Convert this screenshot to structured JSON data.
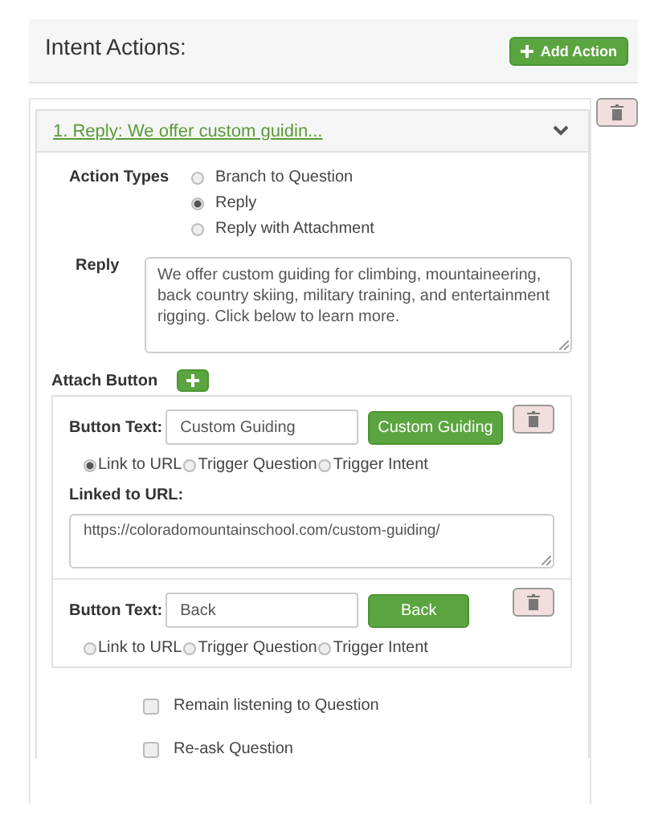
{
  "header": {
    "title": "Intent Actions:",
    "add_button": "Add Action"
  },
  "action": {
    "title": "1. Reply: We offer custom guidin...",
    "expanded": true,
    "action_types_label": "Action Types",
    "action_types": [
      {
        "label": "Branch to Question",
        "selected": false
      },
      {
        "label": "Reply",
        "selected": true
      },
      {
        "label": "Reply with Attachment",
        "selected": false
      }
    ],
    "reply_label": "Reply",
    "reply_text": "We offer custom guiding for climbing, mountaineering, back country skiing, military training, and entertainment rigging. Click below to learn more.",
    "attach_label": "Attach Button",
    "buttons": [
      {
        "label": "Button Text:",
        "value": "Custom Guiding",
        "preview": "Custom Guiding",
        "link_options": [
          {
            "label": "Link to URL",
            "selected": true
          },
          {
            "label": "Trigger Question",
            "selected": false
          },
          {
            "label": "Trigger Intent",
            "selected": false
          }
        ],
        "url_label": "Linked to URL:",
        "url": "https://coloradomountainschool.com/custom-guiding/"
      },
      {
        "label": "Button Text:",
        "value": "Back",
        "preview": "Back",
        "link_options": [
          {
            "label": "Link to URL",
            "selected": false
          },
          {
            "label": "Trigger Question",
            "selected": false
          },
          {
            "label": "Trigger Intent",
            "selected": false
          }
        ]
      }
    ],
    "checkboxes": [
      {
        "label": "Remain listening to Question",
        "checked": false
      },
      {
        "label": "Re-ask Question",
        "checked": false
      }
    ]
  }
}
